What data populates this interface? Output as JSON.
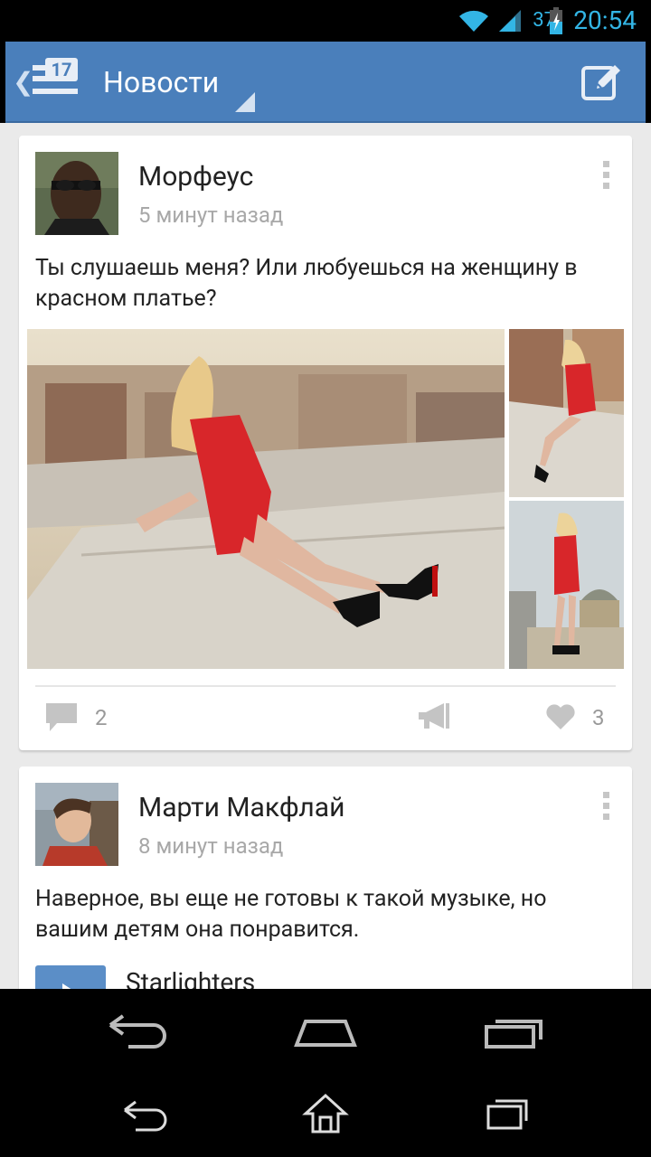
{
  "status_bar": {
    "battery": "37",
    "time": "20:54"
  },
  "action_bar": {
    "badge": "17",
    "title": "Новости"
  },
  "posts": [
    {
      "author": "Морфеус",
      "time": "5 минут назад",
      "text": "Ты слушаешь меня? Или любуешься на женщину в красном платье?",
      "comments": "2",
      "likes": "3"
    },
    {
      "author": "Марти Макфлай",
      "time": "8 минут назад",
      "text": "Наверное, вы еще не готовы к такой музыке, но вашим детям она понравится.",
      "audio_title": "Starlighters"
    }
  ],
  "colors": {
    "action_bar": "#4a7fbb",
    "status_accent": "#33b5e5",
    "dress_red": "#d8262a"
  }
}
